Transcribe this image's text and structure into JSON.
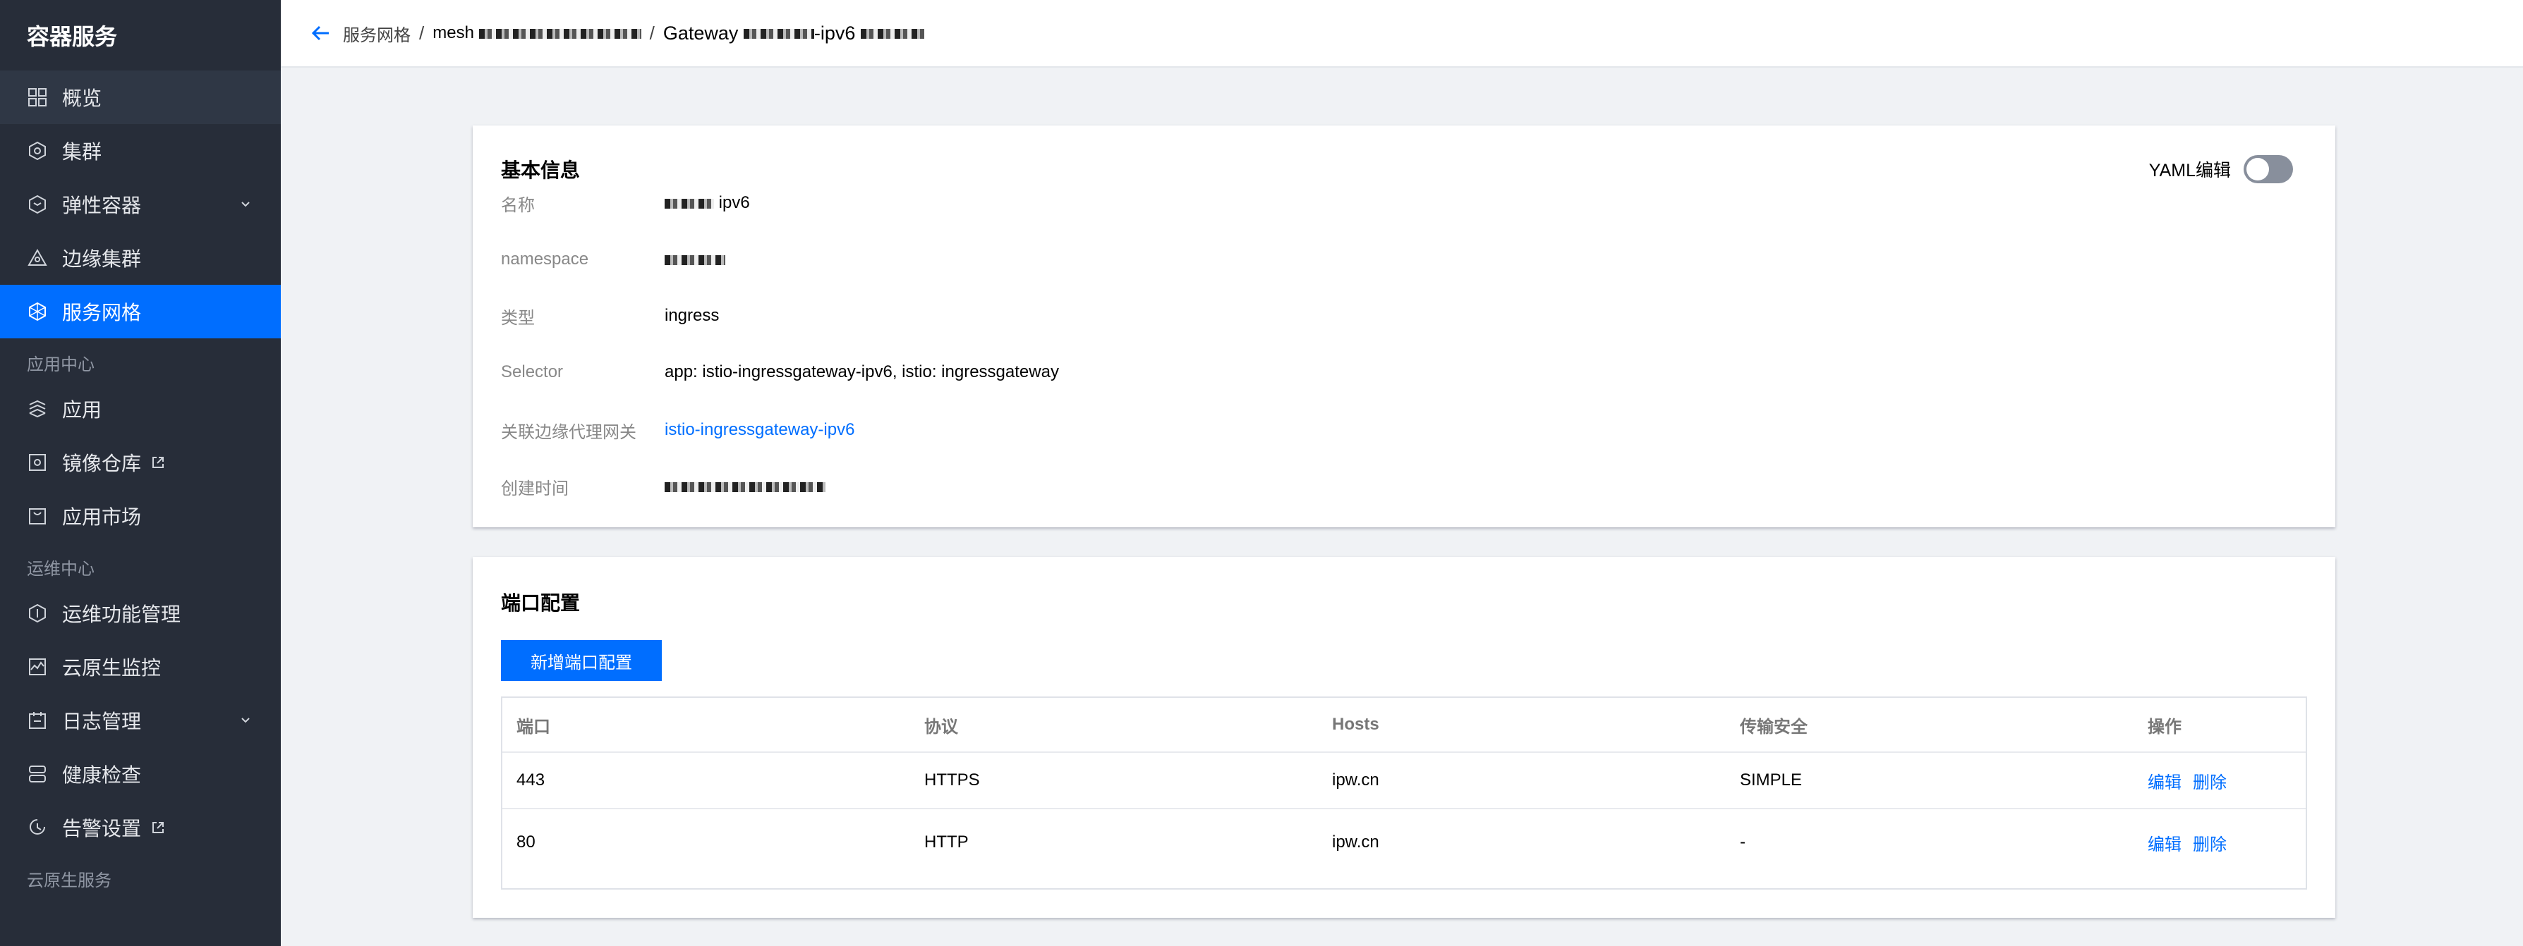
{
  "sidebar": {
    "title": "容器服务",
    "items": [
      {
        "label": "概览",
        "icon": "grid-icon"
      },
      {
        "label": "集群",
        "icon": "cluster-icon"
      },
      {
        "label": "弹性容器",
        "icon": "elastic-icon"
      },
      {
        "label": "边缘集群",
        "icon": "edge-icon"
      },
      {
        "label": "服务网格",
        "icon": "mesh-icon"
      }
    ],
    "group_app": "应用中心",
    "app_items": [
      {
        "label": "应用",
        "icon": "app-icon"
      },
      {
        "label": "镜像仓库",
        "icon": "registry-icon"
      },
      {
        "label": "应用市场",
        "icon": "market-icon"
      }
    ],
    "group_ops": "运维中心",
    "ops_items": [
      {
        "label": "运维功能管理",
        "icon": "ops-icon"
      },
      {
        "label": "云原生监控",
        "icon": "monitor-icon"
      },
      {
        "label": "日志管理",
        "icon": "log-icon"
      },
      {
        "label": "健康检查",
        "icon": "health-icon"
      },
      {
        "label": "告警设置",
        "icon": "alarm-icon"
      }
    ],
    "group_cloud": "云原生服务"
  },
  "header": {
    "crumb1": "服务网格",
    "crumb2": "mesh",
    "crumb3_prefix": "Gateway",
    "crumb3_suffix": "-ipv6"
  },
  "info": {
    "title": "基本信息",
    "yaml_label": "YAML编辑",
    "yaml_enabled": false,
    "fields": {
      "name_label": "名称",
      "name_suffix": "ipv6",
      "namespace_label": "namespace",
      "type_label": "类型",
      "type_value": "ingress",
      "selector_label": "Selector",
      "selector_value": "app: istio-ingressgateway-ipv6, istio: ingressgateway",
      "gateway_label": "关联边缘代理网关",
      "gateway_value": "istio-ingressgateway-ipv6",
      "created_label": "创建时间"
    }
  },
  "ports": {
    "title": "端口配置",
    "add_button": "新增端口配置",
    "columns": [
      "端口",
      "协议",
      "Hosts",
      "传输安全",
      "操作"
    ],
    "rows": [
      {
        "port": "443",
        "protocol": "HTTPS",
        "hosts": "ipw.cn",
        "tls": "SIMPLE",
        "edit": "编辑",
        "delete": "删除"
      },
      {
        "port": "80",
        "protocol": "HTTP",
        "hosts": "ipw.cn",
        "tls": "-",
        "edit": "编辑",
        "delete": "删除"
      }
    ]
  },
  "colors": {
    "sidebar_bg": "#272d39",
    "active": "#006eff",
    "link": "#006eff"
  }
}
